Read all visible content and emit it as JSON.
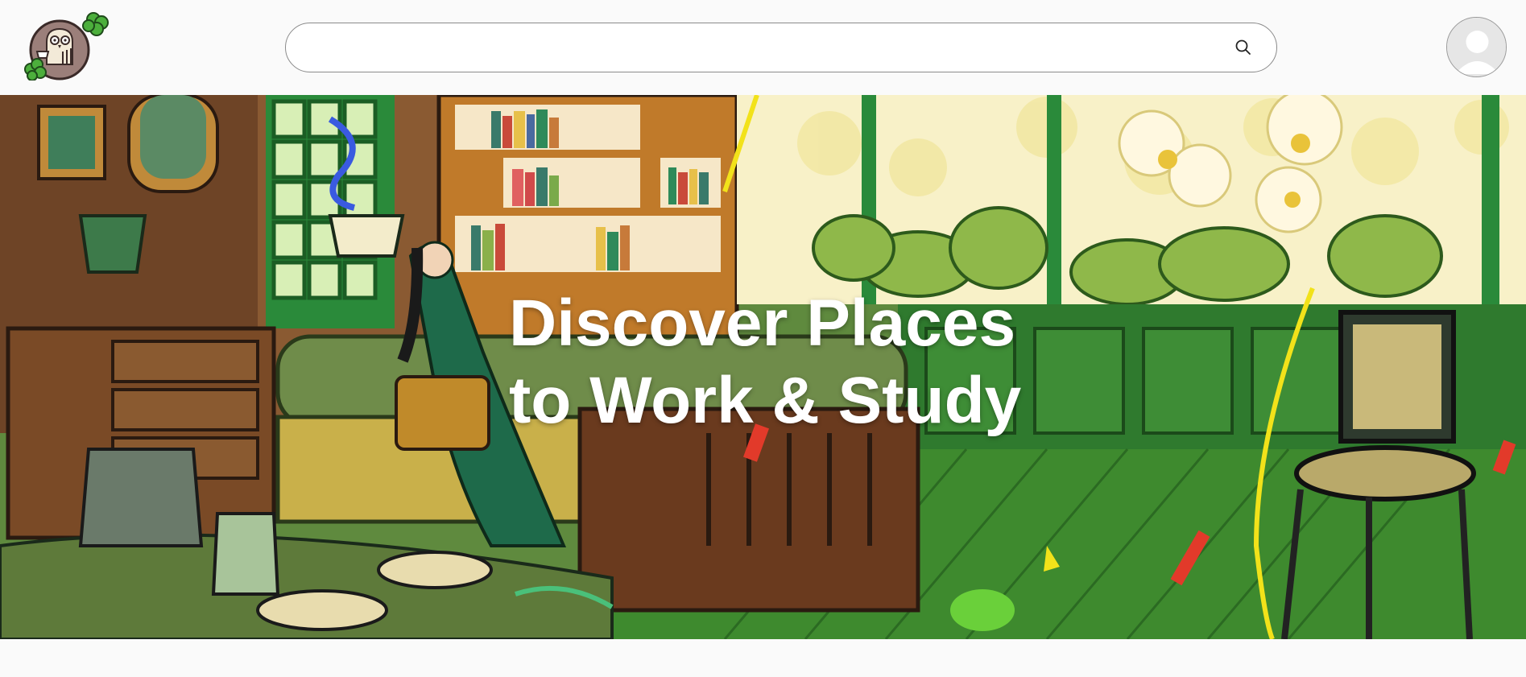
{
  "header": {
    "logo_icon": "owl-coffee-logo",
    "search": {
      "value": "",
      "placeholder": "",
      "icon": "search-icon"
    },
    "avatar_icon": "user-avatar-icon"
  },
  "hero": {
    "title_line1": "Discover Places",
    "title_line2": "to Work & Study",
    "image_description_icon": "illustrated-cozy-study-room"
  },
  "colors": {
    "page_bg": "#fafafa",
    "title_text": "#ffffff",
    "search_border": "#8a8a8a",
    "logo_bg": "#9b7f7a",
    "logo_leaves": "#4caf3c"
  }
}
